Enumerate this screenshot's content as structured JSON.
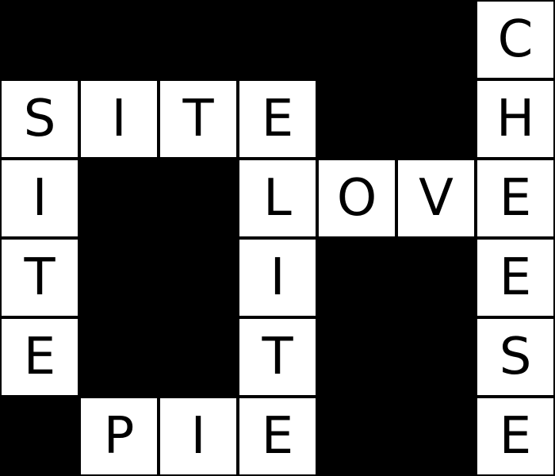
{
  "grid": {
    "rows": [
      [
        "#",
        "#",
        "#",
        "#",
        "#",
        "#",
        "C"
      ],
      [
        "S",
        "I",
        "T",
        "E",
        "#",
        "#",
        "H"
      ],
      [
        "I",
        "#",
        "#",
        "L",
        "O",
        "V",
        "E"
      ],
      [
        "T",
        "#",
        "#",
        "I",
        "#",
        "#",
        "E"
      ],
      [
        "E",
        "#",
        "#",
        "T",
        "#",
        "#",
        "S"
      ],
      [
        "#",
        "P",
        "I",
        "E",
        "#",
        "#",
        "E"
      ]
    ]
  },
  "colors": {
    "block": "#000000",
    "cell": "#ffffff",
    "letter": "#000000",
    "border": "#000000"
  }
}
